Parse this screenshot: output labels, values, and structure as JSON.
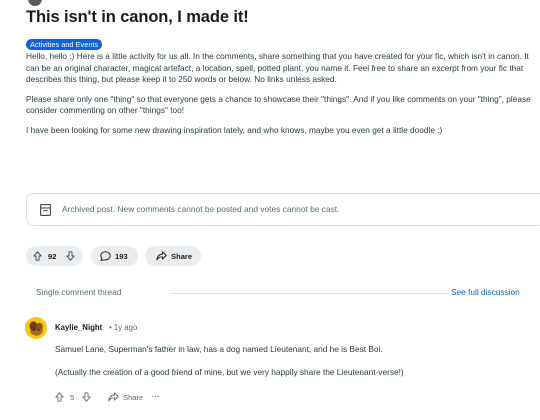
{
  "post": {
    "title": "This isn't in canon, I made it!",
    "flair": "Activities and Events",
    "body": [
      "Hello, hello :) Here is a little activity for us all. In the comments, share something that you have created for your fic, which isn't in canon. It can be an original character, magical artefact, a location, spell, potted plant, you name it. Feel free to share an excerpt from your fic that describes this thing, but please keep it to 250 words or below. No links unless asked.",
      "Please share only one \"thing\" so that everyone gets a chance to showcase their \"things\". And if you like comments on your \"thing\", please consider commenting on other \"things\" too!",
      "I have been looking for some new drawing inspiration lately, and who knows, maybe you even get a little doodle :)"
    ],
    "archived_notice": "Archived post. New comments cannot be posted and votes cannot be cast.",
    "votes": "92",
    "comments": "193",
    "share_label": "Share"
  },
  "thread": {
    "label": "Single comment thread",
    "see_full": "See full discussion"
  },
  "comment": {
    "author": "Kaylie_Night",
    "meta": "• 1y ago",
    "body": [
      "Samuel Lane, Superman's father in law, has a dog named Lieutenant, and he is Best Boi.",
      "(Actually the creation of a good friend of mine, but we very happily share the Lieutenant-verse!)"
    ],
    "votes": "5",
    "share_label": "Share",
    "more_label": "···"
  },
  "colors": {
    "flair_bg": "#0e63d6",
    "link": "#0a65c2",
    "pill_bg": "#eaedef",
    "muted_text": "#576f76",
    "avatar_bg": "#f5c518"
  }
}
